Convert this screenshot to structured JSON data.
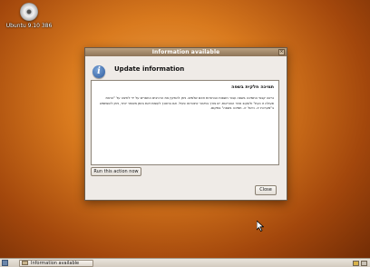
{
  "desktop": {
    "icon": "cd-disc-icon",
    "label": "Ubuntu 9.10 386"
  },
  "dialog": {
    "window_title": "Information available",
    "header_title": "Update information",
    "header_icon": "info-icon",
    "heading": "תמיכה חלקית בשפה",
    "body": "נראה קבצי התמיכה בשפה עבור השפות הבחורות אינם שלמים. ניתן להתקין את הרכיבים החסרים על ידי לחיצה על \"הרצת פעולה זו כעת\" ולעקוב אחר ההוראות. יש צורך בחיבור אינטרנט פעיל. אם ברצונך לעשות זאת בזמן מאוחר יותר, ניתן להשתמש ב\"מערכת <- ניהול <- תמיכה בשפה\" במקום.",
    "run_button": "Run this action now",
    "close_button": "Close"
  },
  "taskbar": {
    "task_label": "Information available"
  },
  "colors": {
    "wallpaper": "#d97a1e",
    "dialog_bg": "#efebe7",
    "titlebar": "#9c8366"
  }
}
